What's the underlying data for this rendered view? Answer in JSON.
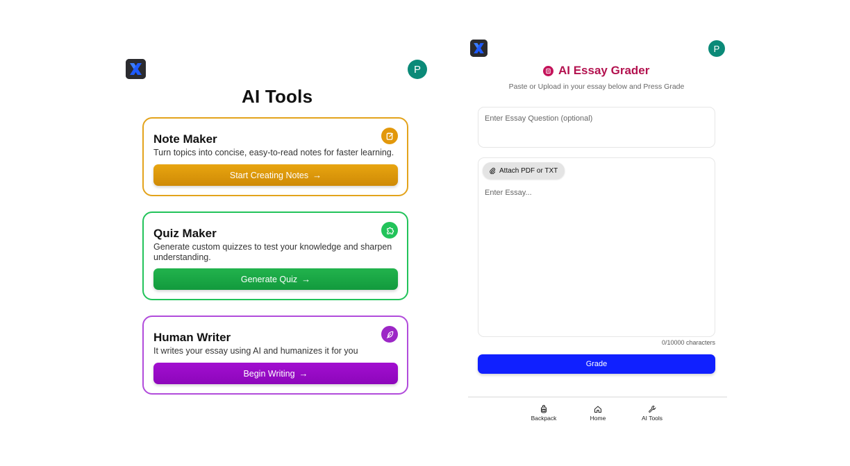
{
  "left": {
    "title": "AI Tools",
    "avatar_letter": "P",
    "cards": [
      {
        "title": "Note Maker",
        "description": "Turn topics into concise, easy-to-read notes for faster learning.",
        "button": "Start Creating Notes",
        "icon": "notepad-icon",
        "color": "#e2980b"
      },
      {
        "title": "Quiz Maker",
        "description": "Generate custom quizzes to test your knowledge and sharpen understanding.",
        "button": "Generate Quiz",
        "icon": "puzzle-icon",
        "color": "#22c35a"
      },
      {
        "title": "Human Writer",
        "description": "It writes your essay using AI and humanizes it for you",
        "button": "Begin Writing",
        "icon": "feather-icon",
        "color": "#9c27c6"
      }
    ]
  },
  "right": {
    "avatar_letter": "P",
    "title": "AI Essay Grader",
    "subtitle": "Paste or Upload in your essay below and Press Grade",
    "question_placeholder": "Enter Essay Question (optional)",
    "attach_label": "Attach PDF or TXT",
    "essay_placeholder": "Enter Essay...",
    "char_count": "0/10000 characters",
    "grade_button": "Grade",
    "accent_color": "#1020ff",
    "title_color": "#b3124f",
    "nav": [
      {
        "label": "Backpack",
        "icon": "backpack-icon"
      },
      {
        "label": "Home",
        "icon": "home-icon"
      },
      {
        "label": "AI Tools",
        "icon": "wrench-icon"
      }
    ]
  }
}
